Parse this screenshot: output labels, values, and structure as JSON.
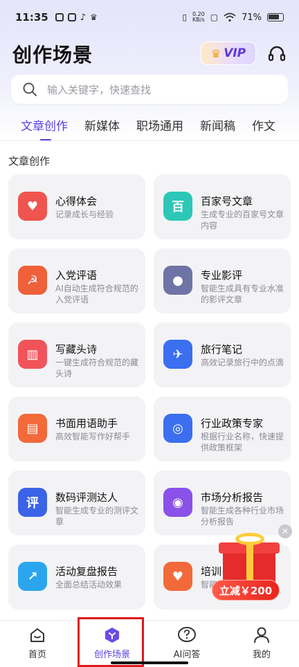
{
  "status_bar": {
    "time": "11:35",
    "speed": "0.20",
    "speed_unit": "KB/s",
    "battery": "71%"
  },
  "header": {
    "title": "创作场景",
    "vip_label": "VIP"
  },
  "search": {
    "placeholder": "输入关键字，快速查找"
  },
  "tabs": [
    {
      "label": "文章创作",
      "active": true
    },
    {
      "label": "新媒体"
    },
    {
      "label": "职场通用"
    },
    {
      "label": "新闻稿"
    },
    {
      "label": "作文"
    }
  ],
  "section_title": "文章创作",
  "cards": [
    {
      "title": "心得体会",
      "desc": "记录成长与经验",
      "icon": "heart-icon",
      "color": "#f0544e",
      "glyph": "♥"
    },
    {
      "title": "百家号文章",
      "desc": "生成专业的百家号文章内容",
      "icon": "baijiahao-icon",
      "color": "#2cc7b6",
      "glyph": "百"
    },
    {
      "title": "入党评语",
      "desc": "AI自动生成符合规范的入党评语",
      "icon": "party-badge-icon",
      "color": "#f0603a",
      "glyph": "☭"
    },
    {
      "title": "专业影评",
      "desc": "智能生成具有专业水准的影评文章",
      "icon": "film-reel-icon",
      "color": "#6f74a6",
      "glyph": "●"
    },
    {
      "title": "写藏头诗",
      "desc": "一键生成符合规范的藏头诗",
      "icon": "poem-scroll-icon",
      "color": "#f0545a",
      "glyph": "▥"
    },
    {
      "title": "旅行笔记",
      "desc": "高效记录旅行中的点滴",
      "icon": "plane-notebook-icon",
      "color": "#3b6ff0",
      "glyph": "✈"
    },
    {
      "title": "书面用语助手",
      "desc": "高效智能写作好帮手",
      "icon": "chat-book-icon",
      "color": "#f36a3a",
      "glyph": "▤"
    },
    {
      "title": "行业政策专家",
      "desc": "根据行业名称，快速提供政策框架",
      "icon": "target-icon",
      "color": "#3b6ff0",
      "glyph": "◎"
    },
    {
      "title": "数码评测达人",
      "desc": "智能生成专业的测评文章",
      "icon": "review-shield-icon",
      "color": "#3b63e8",
      "glyph": "评"
    },
    {
      "title": "市场分析报告",
      "desc": "智能生成各种行业市场分析报告",
      "icon": "market-chart-icon",
      "color": "#8a52e8",
      "glyph": "◉"
    },
    {
      "title": "活动复盘报告",
      "desc": "全面总结活动效果",
      "icon": "activity-chart-icon",
      "color": "#2ba6ee",
      "glyph": "↗"
    },
    {
      "title": "培训",
      "desc": "智能",
      "icon": "training-icon",
      "color": "#f36a3a",
      "glyph": "♥"
    }
  ],
  "promo": {
    "label": "立减￥200"
  },
  "tabbar": [
    {
      "label": "首页"
    },
    {
      "label": "创作场景",
      "active": true
    },
    {
      "label": "AI问答"
    },
    {
      "label": "我的"
    }
  ]
}
